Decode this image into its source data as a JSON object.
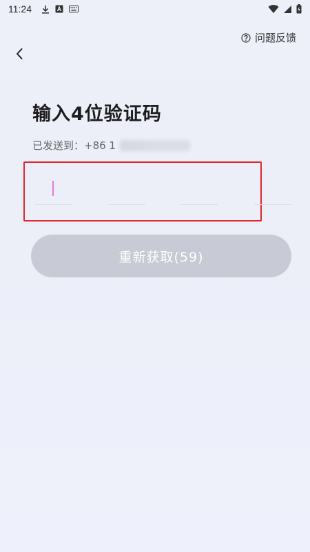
{
  "status_bar": {
    "time": "11:24"
  },
  "header": {
    "feedback_label": "问题反馈",
    "feedback_icon": "help-circle-icon",
    "back_icon": "chevron-left-icon"
  },
  "main": {
    "title": "输入4位验证码",
    "sent_to_prefix": "已发送到：+86 1"
  },
  "code_input": {
    "length": 4,
    "values": [
      "",
      "",
      "",
      ""
    ]
  },
  "resend_button": {
    "label": "重新获取(59)"
  },
  "colors": {
    "highlight_border": "#e0262c",
    "cursor": "#e17ad8",
    "button_disabled": "#c8cad5"
  }
}
